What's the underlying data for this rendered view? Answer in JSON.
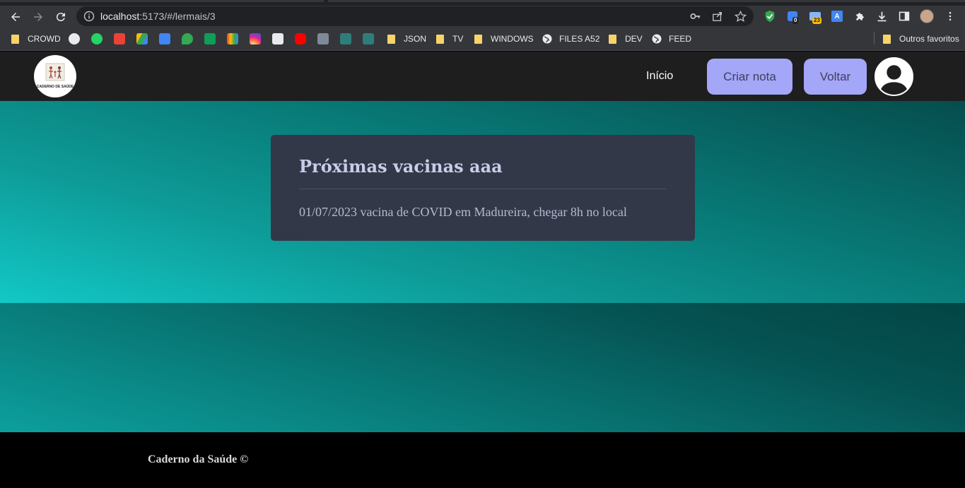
{
  "browser": {
    "url_host": "localhost",
    "url_path": ":5173/#/lermais/3",
    "bookmarks": [
      "CROWD",
      "JSON",
      "TV",
      "WINDOWS",
      "FILES A52",
      "DEV",
      "FEED"
    ],
    "other_favorites": "Outros favoritos",
    "badges": {
      "ext_counter": "0",
      "ext_mail": "23"
    },
    "icons": [
      "back-icon",
      "forward-icon",
      "reload-icon",
      "info-icon",
      "key-icon",
      "share-icon",
      "star-icon",
      "shield-icon",
      "puzzle-icon",
      "download-icon",
      "sidepanel-icon",
      "profile-icon",
      "menu-icon"
    ]
  },
  "header": {
    "logo_text": "CADERNO DE SAÚDE",
    "nav_home": "Início",
    "create_note": "Criar nota",
    "back": "Voltar"
  },
  "note": {
    "title": "Próximas vacinas aaa",
    "body": "01/07/2023 vacina de COVID em Madureira, chegar 8h no local"
  },
  "footer": {
    "text": "Caderno da Saúde ©"
  },
  "colors": {
    "accent": "#a4a6f8",
    "header_bg": "#1e1e1e",
    "card_bg": "#323847",
    "teal_light": "#12c8c6",
    "teal_dark": "#064d4d"
  }
}
